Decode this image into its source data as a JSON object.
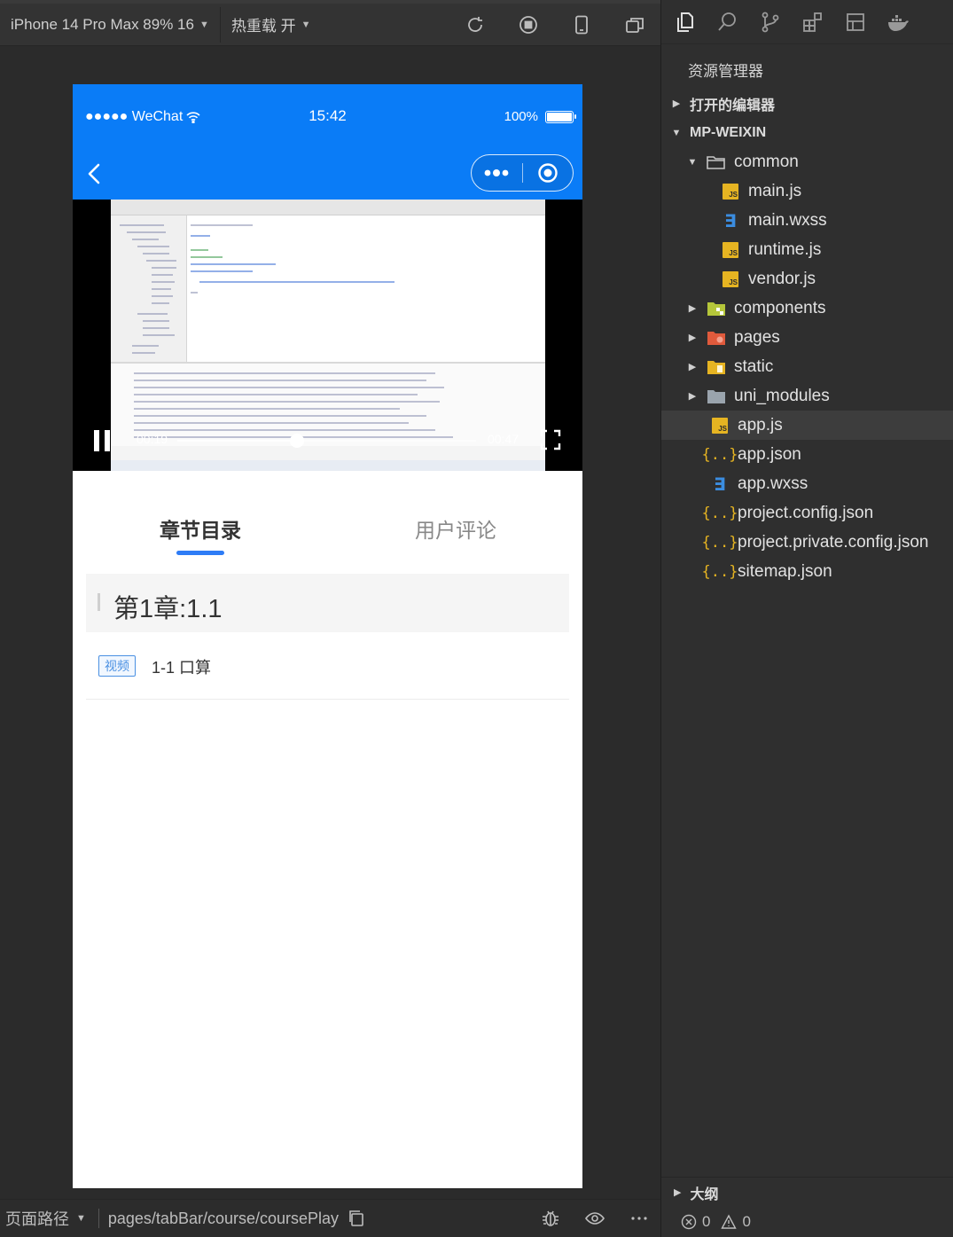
{
  "toolbar": {
    "device": "iPhone 14 Pro Max 89% 16",
    "hot_reload": "热重载 开"
  },
  "phone": {
    "status": {
      "carrier": "●●●●● WeChat",
      "time": "15:42",
      "battery_pct": "100%",
      "battery_level": 1.0
    },
    "video": {
      "current_time": "00:19",
      "duration": "00:47",
      "progress": 0.4
    },
    "tabs": [
      {
        "label": "章节目录"
      },
      {
        "label": "用户评论"
      }
    ],
    "chapter": {
      "title": "第1章:1.1"
    },
    "lesson": {
      "tag": "视频",
      "title": "1-1 口算"
    }
  },
  "bottom_bar": {
    "page_path_label": "页面路径",
    "page_path": "pages/tabBar/course/coursePlay"
  },
  "explorer": {
    "title": "资源管理器",
    "open_editors": "打开的编辑器",
    "project": "MP-WEIXIN",
    "tree": [
      {
        "name": "common",
        "type": "folder",
        "expanded": true
      },
      {
        "name": "main.js",
        "type": "js"
      },
      {
        "name": "main.wxss",
        "type": "css"
      },
      {
        "name": "runtime.js",
        "type": "js"
      },
      {
        "name": "vendor.js",
        "type": "js"
      },
      {
        "name": "components",
        "type": "folder"
      },
      {
        "name": "pages",
        "type": "folder"
      },
      {
        "name": "static",
        "type": "folder"
      },
      {
        "name": "uni_modules",
        "type": "folder"
      },
      {
        "name": "app.js",
        "type": "js",
        "selected": true
      },
      {
        "name": "app.json",
        "type": "json"
      },
      {
        "name": "app.wxss",
        "type": "css"
      },
      {
        "name": "project.config.json",
        "type": "json"
      },
      {
        "name": "project.private.config.json",
        "type": "json"
      },
      {
        "name": "sitemap.json",
        "type": "json"
      }
    ],
    "outline": "大纲",
    "errors": "0",
    "warnings": "0"
  },
  "colors": {
    "accent": "#0a7cf7",
    "tab_indicator": "#2e7cf6",
    "js_icon": "#e6b422",
    "css_icon": "#3b8de0"
  }
}
